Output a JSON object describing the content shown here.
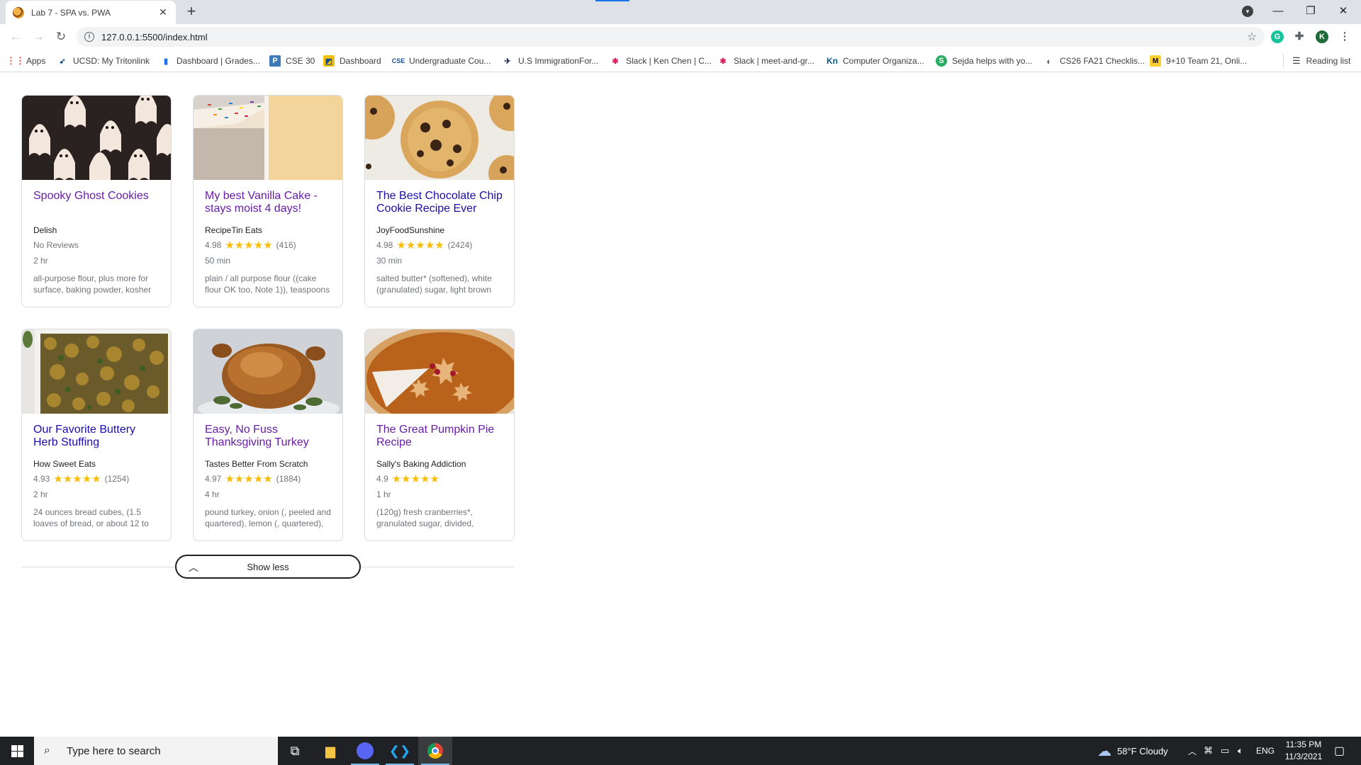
{
  "browser": {
    "tab_title": "Lab 7 - SPA vs. PWA",
    "url": "127.0.0.1:5500/index.html",
    "bookmarks": [
      {
        "label": "Apps",
        "icon": "apps-grid-icon"
      },
      {
        "label": "UCSD: My Tritonlink",
        "icon": "triton-icon"
      },
      {
        "label": "Dashboard | Grades...",
        "icon": "bar-chart-icon"
      },
      {
        "label": "CSE 30",
        "icon": "piazza-icon"
      },
      {
        "label": "Dashboard",
        "icon": "canvas-icon"
      },
      {
        "label": "Undergraduate Cou...",
        "icon": "cse-icon"
      },
      {
        "label": "U.S ImmigrationFor...",
        "icon": "eagle-icon"
      },
      {
        "label": "Slack | Ken Chen | C...",
        "icon": "slack-icon"
      },
      {
        "label": "Slack | meet-and-gr...",
        "icon": "slack-icon"
      },
      {
        "label": "Computer Organiza...",
        "icon": "kn-icon"
      },
      {
        "label": "Sejda helps with yo...",
        "icon": "sejda-icon"
      },
      {
        "label": "CS26 FA21 Checklis...",
        "icon": "circle-link-icon"
      },
      {
        "label": "9+10 Team 21, Onli...",
        "icon": "miro-icon"
      }
    ],
    "reading_list": "Reading list",
    "profile_initial": "K"
  },
  "recipes": [
    {
      "title": "Spooky Ghost Cookies",
      "org": "Delish",
      "rating": "No Reviews",
      "stars": "",
      "count": "",
      "time": "2 hr",
      "ingredients": "all-purpose flour, plus more for surface, baking powder, kosher",
      "visited": true
    },
    {
      "title": "My best Vanilla Cake - stays moist 4 days!",
      "org": "RecipeTin Eats",
      "rating": "4.98",
      "stars": "★★★★★",
      "count": "(416)",
      "time": "50 min",
      "ingredients": "plain / all purpose flour ((cake flour OK too, Note 1)), teaspoons",
      "visited": true
    },
    {
      "title": "The Best Chocolate Chip Cookie Recipe Ever",
      "org": "JoyFoodSunshine",
      "rating": "4.98",
      "stars": "★★★★★",
      "count": "(2424)",
      "time": "30 min",
      "ingredients": "salted butter* (softened), white (granulated) sugar, light brown",
      "visited": false
    },
    {
      "title": "Our Favorite Buttery Herb Stuffing",
      "org": "How Sweet Eats",
      "rating": "4.93",
      "stars": "★★★★★",
      "count": "(1254)",
      "time": "2 hr",
      "ingredients": "24 ounces bread cubes, (1.5 loaves of bread, or about 12 to",
      "visited": false
    },
    {
      "title": "Easy, No Fuss Thanksgiving Turkey",
      "org": "Tastes Better From Scratch",
      "rating": "4.97",
      "stars": "★★★★★",
      "count": "(1884)",
      "time": "4 hr",
      "ingredients": "pound turkey, onion (, peeled and quartered), lemon (, quartered),",
      "visited": true
    },
    {
      "title": "The Great Pumpkin Pie Recipe",
      "org": "Sally's Baking Addiction",
      "rating": "4.9",
      "stars": "★★★★★",
      "count": "",
      "time": "1 hr",
      "ingredients": "(120g) fresh cranberries*, granulated sugar, divided,",
      "visited": true
    }
  ],
  "show_less_label": "Show less",
  "taskbar": {
    "search_placeholder": "Type here to search",
    "weather": "58°F  Cloudy",
    "language": "ENG",
    "time": "11:35 PM",
    "date": "11/3/2021"
  }
}
